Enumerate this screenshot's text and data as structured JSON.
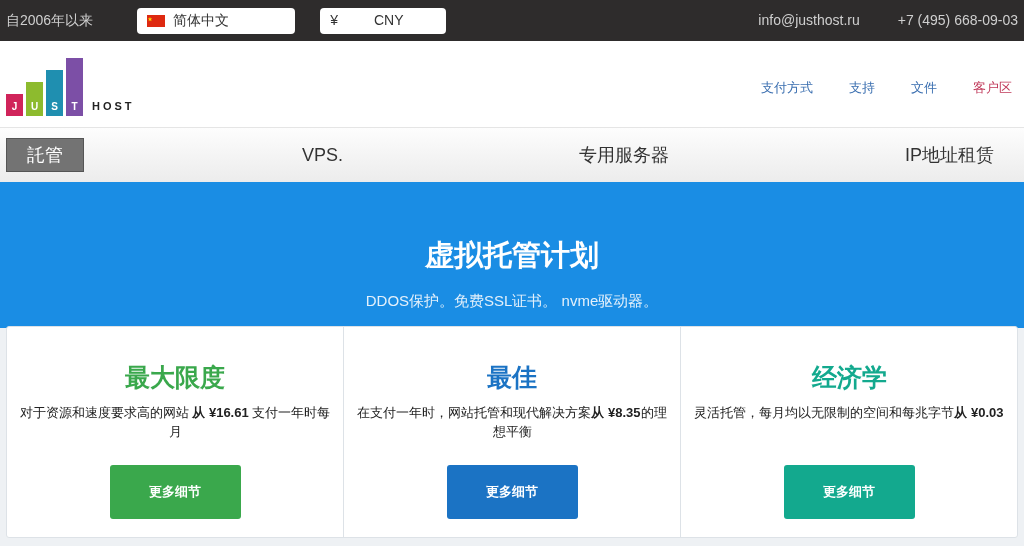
{
  "top_bar": {
    "since": "自2006年以来",
    "language": "简体中文",
    "currency_symbol": "¥",
    "currency": "CNY",
    "email": "info@justhost.ru",
    "phone": "+7 (495) 668-09-03"
  },
  "logo": {
    "letters": [
      "J",
      "U",
      "S",
      "T"
    ],
    "word": "HOST"
  },
  "header_links": [
    {
      "label": "支付方式",
      "kind": "plain"
    },
    {
      "label": "支持",
      "kind": "plain"
    },
    {
      "label": "文件",
      "kind": "plain"
    },
    {
      "label": "客户区",
      "kind": "account"
    }
  ],
  "nav": [
    {
      "label": "託管",
      "selected": true
    },
    {
      "label": "VPS.",
      "selected": false
    },
    {
      "label": "专用服务器",
      "selected": false
    },
    {
      "label": "IP地址租赁",
      "selected": false
    }
  ],
  "hero": {
    "title": "虚拟托管计划",
    "subtitle": "DDOS保护。免费SSL证书。 nvme驱动器。"
  },
  "plans": [
    {
      "name": "最大限度",
      "color": "#3aa84c",
      "description": "对于资源和速度要求高的网站 **从 ¥16.61** 支付一年时每月",
      "button": "更多细节"
    },
    {
      "name": "最佳",
      "color": "#1b73c4",
      "description": "在支付一年时，网站托管和现代解决方案**从 ¥8.35**的理想平衡",
      "button": "更多细节"
    },
    {
      "name": "经济学",
      "color": "#13a98e",
      "description": "灵活托管，每月均以无限制的空间和每兆字节**从 ¥0.03**",
      "button": "更多细节"
    }
  ]
}
